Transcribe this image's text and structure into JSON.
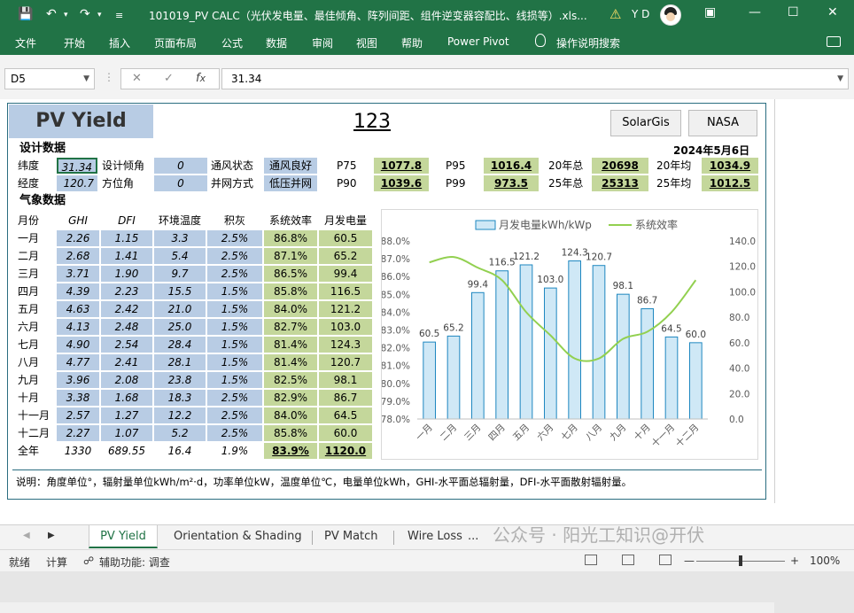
{
  "window": {
    "title": "101019_PV CALC（光伏发电量、最佳倾角、阵列间距、组件逆变器容配比、线损等）.xls...",
    "user": "Y D"
  },
  "ribbon": {
    "tabs": [
      "文件",
      "开始",
      "插入",
      "页面布局",
      "公式",
      "数据",
      "审阅",
      "视图",
      "帮助",
      "Power Pivot"
    ],
    "search": "操作说明搜索"
  },
  "formula_bar": {
    "name_box": "D5",
    "formula": "31.34"
  },
  "sheet": {
    "title": "PV Yield",
    "project_no": "123",
    "buttons": [
      "SolarGis",
      "NASA"
    ],
    "date": "2024年5月6日",
    "design_header": "设计数据",
    "weather_header": "气象数据",
    "params": {
      "lat_label": "纬度",
      "lat": "31.34",
      "lon_label": "经度",
      "lon": "120.7",
      "tilt_label": "设计倾角",
      "tilt": "0",
      "azimuth_label": "方位角",
      "azimuth": "0",
      "vent_label": "通风状态",
      "vent": "通风良好",
      "grid_label": "并网方式",
      "grid": "低压并网",
      "p75_label": "P75",
      "p75": "1077.8",
      "p90_label": "P90",
      "p90": "1039.6",
      "p95_label": "P95",
      "p95": "1016.4",
      "p99_label": "P99",
      "p99": "973.5",
      "total20_label": "20年总",
      "total20": "20698",
      "total25_label": "25年总",
      "total25": "25313",
      "avg20_label": "20年均",
      "avg20": "1034.9",
      "avg25_label": "25年均",
      "avg25": "1012.5"
    },
    "columns": [
      "月份",
      "GHI",
      "DFI",
      "环境温度",
      "积灰",
      "系统效率",
      "月发电量"
    ],
    "rows": [
      [
        "一月",
        "2.26",
        "1.15",
        "3.3",
        "2.5%",
        "86.8%",
        "60.5"
      ],
      [
        "二月",
        "2.68",
        "1.41",
        "5.4",
        "2.5%",
        "87.1%",
        "65.2"
      ],
      [
        "三月",
        "3.71",
        "1.90",
        "9.7",
        "2.5%",
        "86.5%",
        "99.4"
      ],
      [
        "四月",
        "4.39",
        "2.23",
        "15.5",
        "1.5%",
        "85.8%",
        "116.5"
      ],
      [
        "五月",
        "4.63",
        "2.42",
        "21.0",
        "1.5%",
        "84.0%",
        "121.2"
      ],
      [
        "六月",
        "4.13",
        "2.48",
        "25.0",
        "1.5%",
        "82.7%",
        "103.0"
      ],
      [
        "七月",
        "4.90",
        "2.54",
        "28.4",
        "1.5%",
        "81.4%",
        "124.3"
      ],
      [
        "八月",
        "4.77",
        "2.41",
        "28.1",
        "1.5%",
        "81.4%",
        "120.7"
      ],
      [
        "九月",
        "3.96",
        "2.08",
        "23.8",
        "1.5%",
        "82.5%",
        "98.1"
      ],
      [
        "十月",
        "3.38",
        "1.68",
        "18.3",
        "2.5%",
        "82.9%",
        "86.7"
      ],
      [
        "十一月",
        "2.57",
        "1.27",
        "12.2",
        "2.5%",
        "84.0%",
        "64.5"
      ],
      [
        "十二月",
        "2.27",
        "1.07",
        "5.2",
        "2.5%",
        "85.8%",
        "60.0"
      ]
    ],
    "total_row": [
      "全年",
      "1330",
      "689.55",
      "16.4",
      "1.9%",
      "83.9%",
      "1120.0"
    ],
    "note": "说明：角度单位°，辐射量单位kWh/m²·d，功率单位kW，温度单位℃，电量单位kWh，GHI-水平面总辐射量，DFI-水平面散射辐射量。"
  },
  "chart_data": {
    "type": "bar",
    "categories": [
      "一月",
      "二月",
      "三月",
      "四月",
      "五月",
      "六月",
      "七月",
      "八月",
      "九月",
      "十月",
      "十一月",
      "十二月"
    ],
    "series": [
      {
        "name": "月发电量kWh/kWp",
        "type": "bar",
        "axis": "right",
        "values": [
          60.5,
          65.2,
          99.4,
          116.5,
          121.2,
          103.0,
          124.3,
          120.7,
          98.1,
          86.7,
          64.5,
          60.0
        ]
      },
      {
        "name": "系统效率",
        "type": "line",
        "axis": "left",
        "values": [
          86.8,
          87.1,
          86.5,
          85.8,
          84.0,
          82.7,
          81.4,
          81.4,
          82.5,
          82.9,
          84.0,
          85.8
        ]
      }
    ],
    "left_axis": {
      "min": 78,
      "max": 88,
      "step": 1,
      "ticks": [
        "78.0%",
        "79.0%",
        "80.0%",
        "81.0%",
        "82.0%",
        "83.0%",
        "84.0%",
        "85.0%",
        "86.0%",
        "87.0%",
        "88.0%"
      ]
    },
    "right_axis": {
      "min": 0,
      "max": 140,
      "step": 20,
      "ticks": [
        "0.0",
        "20.0",
        "40.0",
        "60.0",
        "80.0",
        "100.0",
        "120.0",
        "140.0"
      ]
    },
    "data_labels": [
      "60.5",
      "65.2",
      "99.4",
      "116.5",
      "121.2",
      "103.0",
      "124.3",
      "120.7",
      "98.1",
      "86.7",
      "64.5",
      "60.0"
    ],
    "legend": "top",
    "colors": {
      "bar_fill": "#cfe8f6",
      "bar_edge": "#1e87c0",
      "line": "#92d050"
    }
  },
  "sheet_tabs": [
    "PV Yield",
    "Orientation & Shading",
    "PV Match",
    "Wire Loss",
    "..."
  ],
  "status": {
    "ready": "就绪",
    "calc": "计算",
    "accessibility": "辅助功能: 调查",
    "zoom": "100%"
  },
  "watermark": "公众号 · 阳光工知识@开伏",
  "colors": {
    "excel_green": "#217346",
    "cell_blue": "#b8cce4",
    "cell_green": "#c4d79b"
  }
}
